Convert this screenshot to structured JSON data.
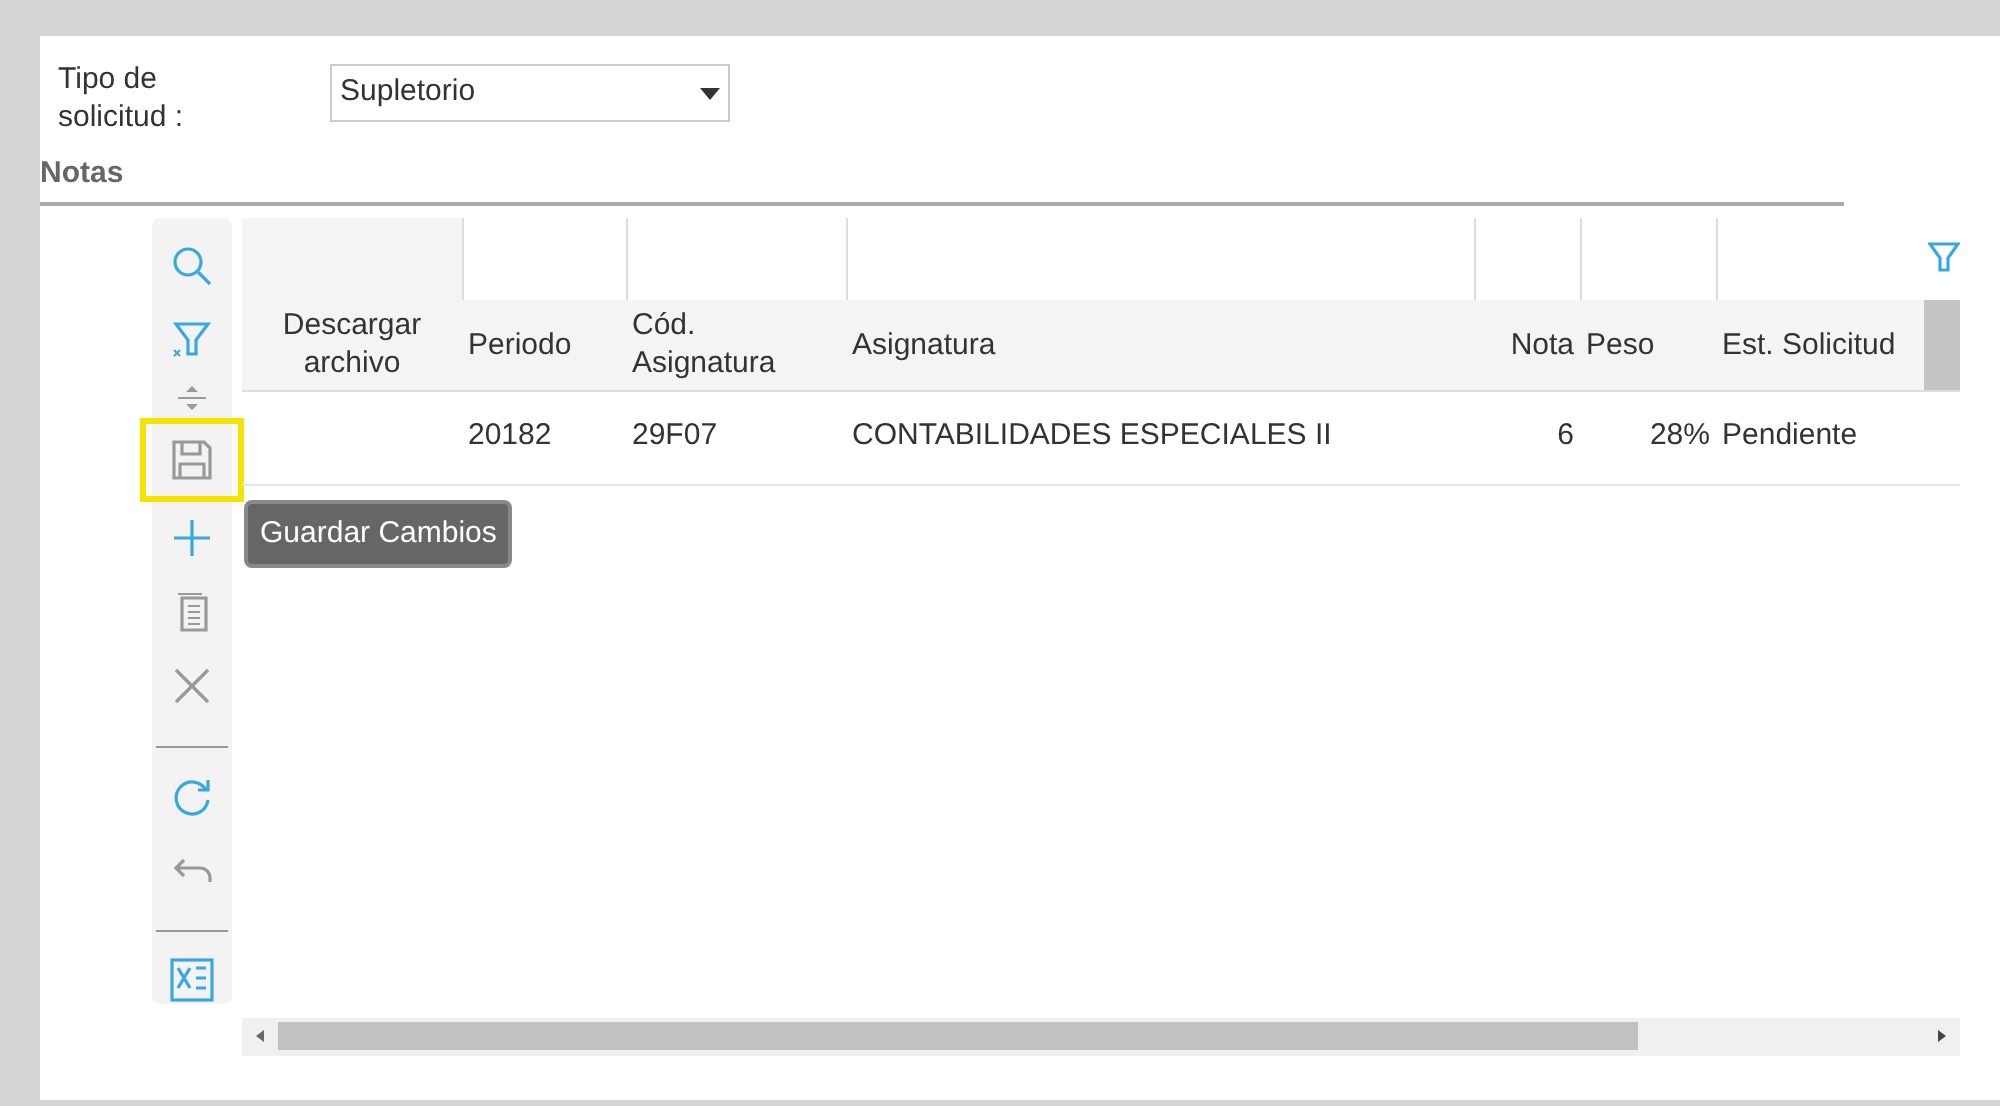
{
  "form": {
    "label": "Tipo de solicitud :",
    "select": {
      "value": "Supletorio"
    }
  },
  "section": {
    "title": "Notas"
  },
  "toolbar": [
    {
      "buttons": [
        {
          "kind": "search",
          "disabled": false,
          "highlighted": false
        },
        {
          "kind": "clear-filter",
          "disabled": false,
          "highlighted": false
        },
        {
          "kind": "resize",
          "disabled": true,
          "highlighted": false
        },
        {
          "kind": "save",
          "disabled": true,
          "highlighted": true
        },
        {
          "kind": "add",
          "disabled": false,
          "highlighted": false
        },
        {
          "kind": "copy",
          "disabled": true,
          "highlighted": false
        },
        {
          "kind": "delete",
          "disabled": true,
          "highlighted": false
        }
      ]
    },
    {
      "buttons": [
        {
          "kind": "refresh",
          "disabled": false,
          "highlighted": false
        },
        {
          "kind": "undo",
          "disabled": true,
          "highlighted": false
        }
      ]
    },
    {
      "buttons": [
        {
          "kind": "excel",
          "disabled": false,
          "highlighted": false
        }
      ]
    }
  ],
  "tooltip": {
    "text": "Guardar Cambios"
  },
  "table": {
    "columns": [
      "Descargar archivo",
      "Periodo",
      "Cód. Asignatura",
      "Asignatura",
      "Nota",
      "Peso",
      "Est. Solicitud"
    ],
    "rows": [
      {
        "cells": [
          "",
          "20182",
          "29F07",
          "CONTABILIDADES ESPECIALES II",
          "6",
          "28%",
          "Pendiente"
        ]
      }
    ]
  }
}
